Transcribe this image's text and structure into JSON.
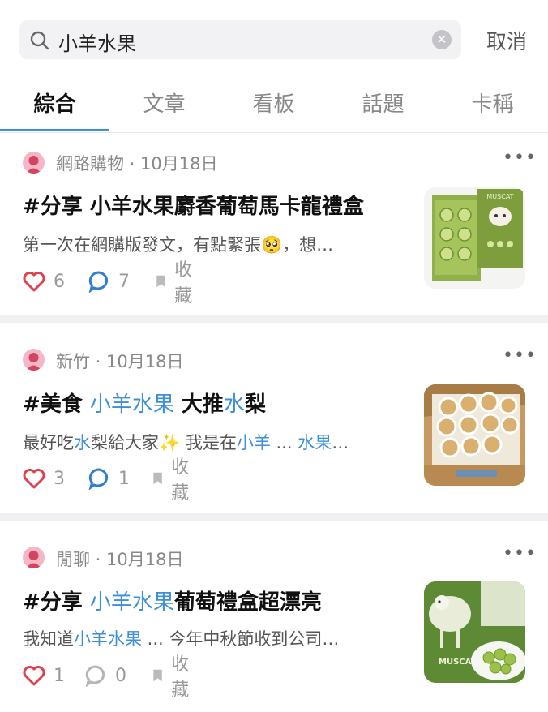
{
  "search": {
    "query": "小羊水果",
    "cancel_label": "取消"
  },
  "tabs": [
    {
      "label": "綜合"
    },
    {
      "label": "文章"
    },
    {
      "label": "看板"
    },
    {
      "label": "話題"
    },
    {
      "label": "卡稱"
    }
  ],
  "posts": [
    {
      "board": "網路購物",
      "date": "10月18日",
      "title": "#分享 小羊水果麝香葡萄馬卡龍禮盒",
      "snippet": "第一次在網購版發文，有點緊張🥺，想…",
      "likes": "6",
      "comments": "7",
      "save_label": "收藏",
      "thumb_text": "MUSCAT"
    },
    {
      "board": "新竹",
      "date": "10月18日",
      "title_prefix": "#美食 ",
      "title_hl": "小羊水果",
      "title_mid": " 大推",
      "title_hl2": "水",
      "title_suffix": "梨",
      "snippet_a": "最好吃",
      "snippet_hl": "水",
      "snippet_b": "梨給大家✨ 我是在",
      "snippet_hl2": "小羊",
      "snippet_c": " ... ",
      "snippet_hl3": "水果",
      "snippet_d": "…",
      "likes": "3",
      "comments": "1",
      "save_label": "收藏"
    },
    {
      "board": "閒聊",
      "date": "10月18日",
      "title_prefix": "#分享 ",
      "title_hl": "小羊水果",
      "title_suffix": "葡萄禮盒超漂亮",
      "snippet_a": "我知道",
      "snippet_hl": "小羊水果",
      "snippet_b": " ... 今年中秋節收到公司…",
      "likes": "1",
      "comments": "0",
      "save_label": "收藏",
      "thumb_text": "MUSCAT"
    }
  ],
  "colors": {
    "accent": "#3d8fd9",
    "like": "#e0414f",
    "comment": "#2f7fd0"
  },
  "icons": [
    "search-icon",
    "clear-icon",
    "more-icon",
    "heart-icon",
    "comment-icon",
    "bookmark-icon"
  ]
}
